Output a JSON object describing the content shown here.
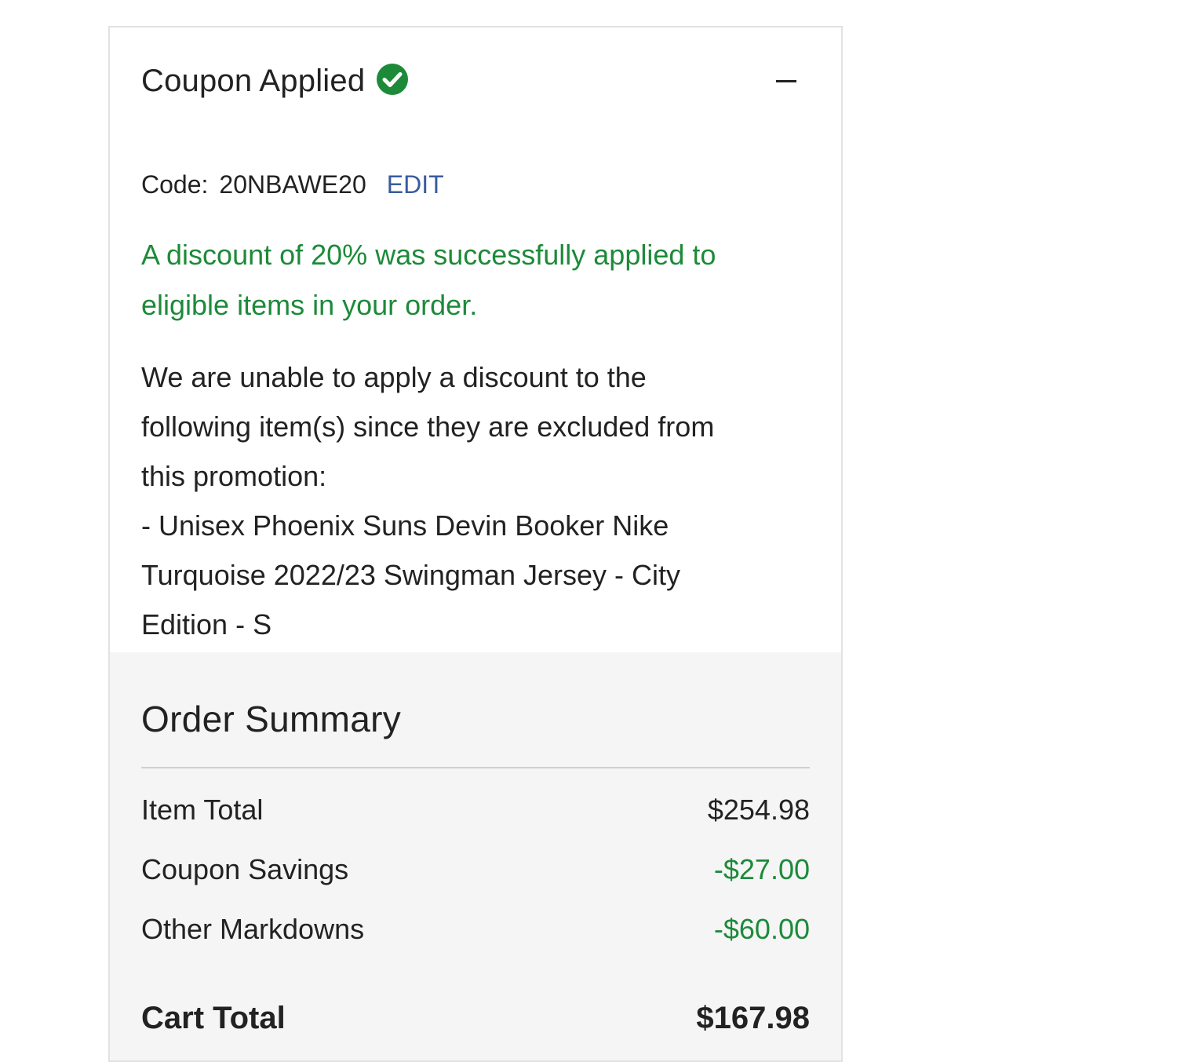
{
  "coupon": {
    "title": "Coupon Applied",
    "code_label": "Code:",
    "code_value": "20NBAWE20",
    "edit_label": "EDIT",
    "success_message": "A discount of 20% was successfully applied to eligible items in your order.",
    "exclusion_lines": [
      "We are unable to apply a discount to the",
      "following item(s) since they are excluded from",
      "this promotion:",
      "- Unisex Phoenix Suns Devin Booker Nike",
      "Turquoise 2022/23 Swingman Jersey - City",
      "Edition - S"
    ],
    "status_icon": "check-circle-icon",
    "collapse_icon": "minus-icon"
  },
  "summary": {
    "title": "Order Summary",
    "rows": [
      {
        "label": "Item Total",
        "value": "$254.98"
      },
      {
        "label": "Coupon Savings",
        "value": "-$27.00"
      },
      {
        "label": "Other Markdowns",
        "value": "-$60.00"
      },
      {
        "label": "Cart Total",
        "value": "$167.98"
      }
    ]
  },
  "colors": {
    "success_green": "#1d8a3a",
    "link_blue": "#3a5ba0",
    "summary_bg": "#f5f5f6",
    "border": "#e2e2e2"
  }
}
